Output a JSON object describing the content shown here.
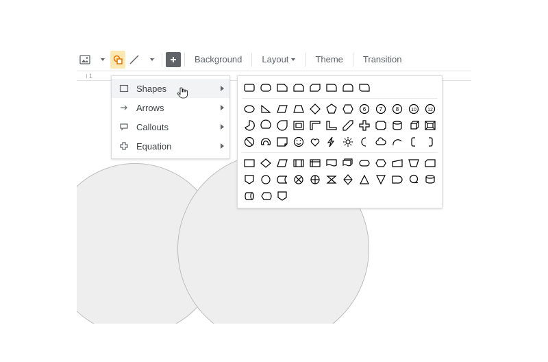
{
  "toolbar": {
    "buttons": {
      "image": "image-icon",
      "shape": "shape-icon",
      "line": "line-icon",
      "add": "add-icon"
    },
    "background_label": "Background",
    "layout_label": "Layout",
    "theme_label": "Theme",
    "transition_label": "Transition"
  },
  "ruler": {
    "tick_label": "1"
  },
  "menu": {
    "items": [
      {
        "label": "Shapes",
        "icon": "rectangle-icon"
      },
      {
        "label": "Arrows",
        "icon": "arrow-icon"
      },
      {
        "label": "Callouts",
        "icon": "callout-icon"
      },
      {
        "label": "Equation",
        "icon": "plus-icon"
      }
    ]
  },
  "palette": {
    "group1_shape_count": 8,
    "group2_shape_count": 36,
    "group3_shape_count": 27
  }
}
